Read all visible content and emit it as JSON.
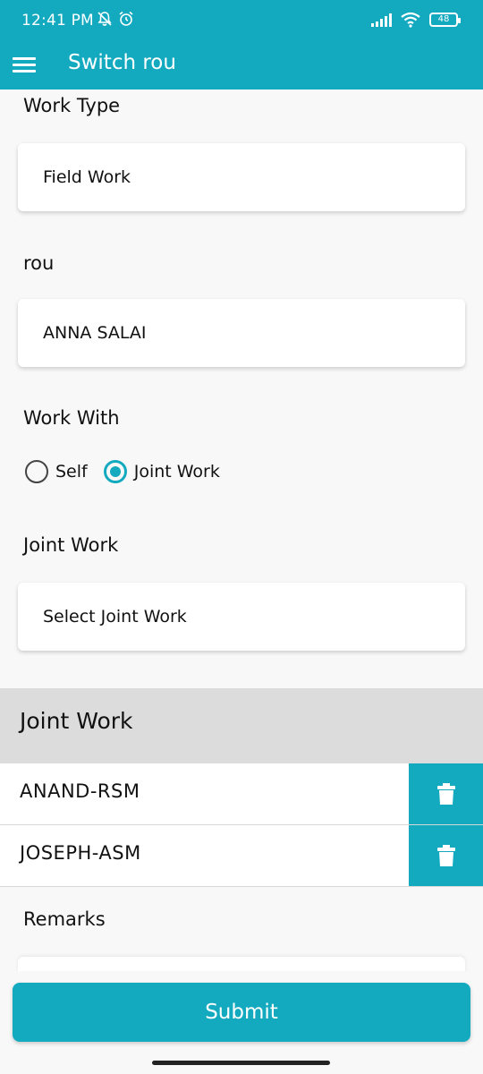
{
  "status_bar": {
    "time": "12:41 PM",
    "battery": "48"
  },
  "app_bar": {
    "title": "Switch rou"
  },
  "form": {
    "work_type_label": "Work Type",
    "work_type_value": "Field Work",
    "rou_label": "rou",
    "rou_value": "ANNA SALAI",
    "work_with_label": "Work With",
    "work_with_options": [
      {
        "label": "Self",
        "selected": false
      },
      {
        "label": "Joint Work",
        "selected": true
      }
    ],
    "joint_work_label": "Joint Work",
    "joint_work_placeholder": "Select Joint Work"
  },
  "joint_work_section": {
    "title": "Joint Work",
    "items": [
      {
        "name": "ANAND-RSM"
      },
      {
        "name": "JOSEPH-ASM"
      }
    ]
  },
  "remarks": {
    "label": "Remarks"
  },
  "submit_label": "Submit",
  "colors": {
    "accent": "#13aac0"
  }
}
